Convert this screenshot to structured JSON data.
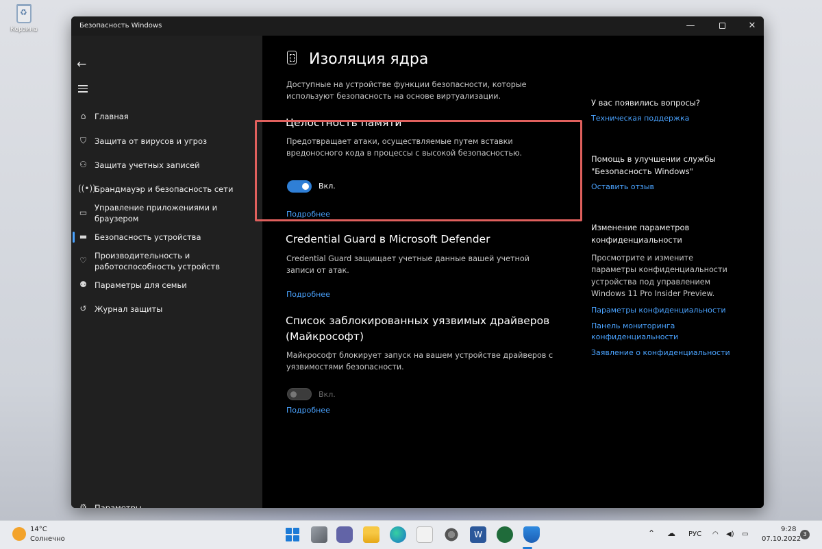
{
  "desktop": {
    "recycle_bin_label": "Корзина"
  },
  "window": {
    "title": "Безопасность Windows",
    "controls": {
      "minimize": "—",
      "close": "✕"
    }
  },
  "sidebar": {
    "back_icon": "←",
    "items": [
      {
        "label": "Главная",
        "icon": "home-icon"
      },
      {
        "label": "Защита от вирусов и угроз",
        "icon": "shield-icon"
      },
      {
        "label": "Защита учетных записей",
        "icon": "person-icon"
      },
      {
        "label": "Брандмауэр и безопасность сети",
        "icon": "wifi-icon"
      },
      {
        "label": "Управление приложениями и",
        "label2": "браузером",
        "icon": "browser-icon"
      },
      {
        "label": "Безопасность устройства",
        "icon": "laptop-icon",
        "active": true
      },
      {
        "label": "Производительность и",
        "label2": "работоспособность устройств",
        "icon": "heart-icon"
      },
      {
        "label": "Параметры для семьи",
        "icon": "family-icon"
      },
      {
        "label": "Журнал защиты",
        "icon": "history-icon"
      }
    ],
    "settings_label": "Параметры"
  },
  "main": {
    "title": "Изоляция ядра",
    "intro_line1": "Доступные на устройстве функции безопасности, которые",
    "intro_line2": "используют безопасность на основе виртуализации.",
    "memory_integrity": {
      "title": "Целостность памяти",
      "desc_line1": "Предотвращает атаки, осуществляемые путем вставки",
      "desc_line2": "вредоносного кода в процессы с высокой безопасностью.",
      "toggle_label": "Вкл.",
      "toggle_on": true,
      "more_link": "Подробнее"
    },
    "credential_guard": {
      "title": "Credential Guard в Microsoft Defender",
      "desc_line1": "Credential Guard защищает учетные данные вашей учетной",
      "desc_line2": "записи от атак.",
      "more_link": "Подробнее"
    },
    "blocked_drivers": {
      "title_line1": "Список заблокированных уязвимых драйверов",
      "title_line2": "(Майкрософт)",
      "desc_line1": "Майкрософт блокирует запуск на вашем устройстве драйверов с",
      "desc_line2": "уязвимостями безопасности.",
      "toggle_label": "Вкл.",
      "toggle_on": false,
      "more_link": "Подробнее"
    }
  },
  "aside": {
    "questions_title": "У вас появились вопросы?",
    "support_link": "Техническая поддержка",
    "improve_title_line1": "Помощь в улучшении службы",
    "improve_title_line2": "\"Безопасность Windows\"",
    "feedback_link": "Оставить отзыв",
    "privacy_title_line1": "Изменение параметров",
    "privacy_title_line2": "конфиденциальности",
    "privacy_desc_line1": "Просмотрите и измените",
    "privacy_desc_line2": "параметры конфиденциальности",
    "privacy_desc_line3": "устройства под управлением",
    "privacy_desc_line4": "Windows 11 Pro Insider Preview.",
    "privacy_settings_link": "Параметры конфиденциальности",
    "monitoring_link_line1": "Панель мониторинга",
    "monitoring_link_line2": "конфиденциальности",
    "statement_link": "Заявление о конфиденциальности"
  },
  "taskbar": {
    "weather_temp": "14°C",
    "weather_desc": "Солнечно",
    "lang": "РУС",
    "time": "9:28",
    "date": "07.10.2022",
    "notifications": "3",
    "apps": [
      "start-icon",
      "task-view-icon",
      "chat-icon",
      "explorer-icon",
      "edge-icon",
      "store-icon",
      "settings-icon",
      "word-icon",
      "terminal-icon",
      "security-icon"
    ]
  },
  "colors": {
    "accent": "#2f7fd6",
    "link": "#4aa3ff",
    "highlight": "#e0605d"
  }
}
